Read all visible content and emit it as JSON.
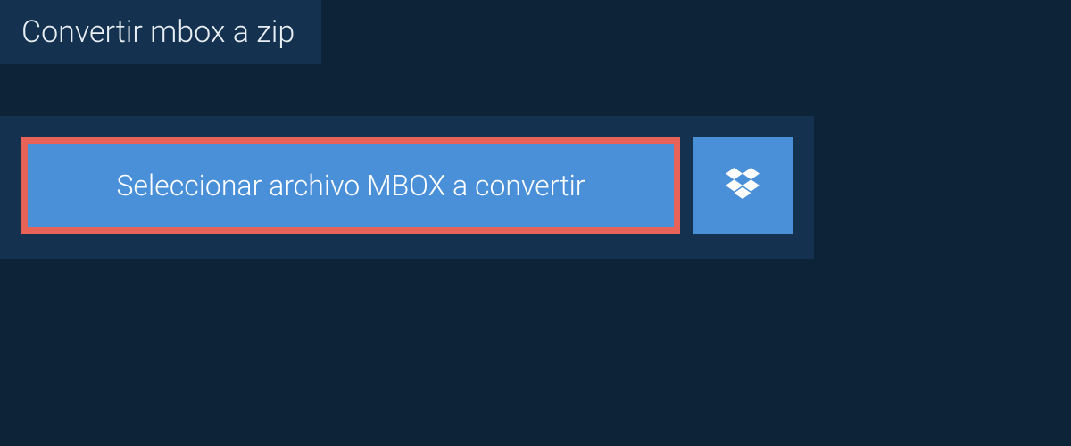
{
  "tab": {
    "title": "Convertir mbox a zip"
  },
  "buttons": {
    "select_label": "Seleccionar archivo MBOX a convertir",
    "dropbox_icon": "dropbox"
  },
  "colors": {
    "background": "#0d2438",
    "panel": "#14324f",
    "button": "#4a90d9",
    "highlight_border": "#e76257",
    "text": "#ffffff"
  }
}
